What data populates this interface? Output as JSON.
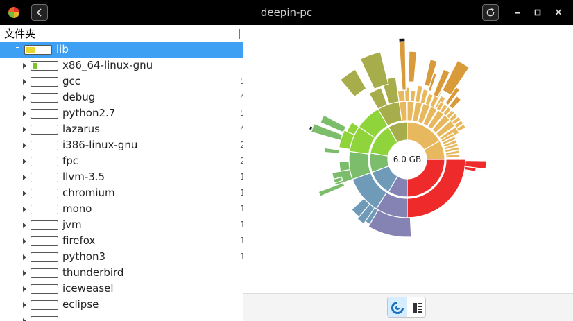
{
  "window": {
    "title": "deepin-pc"
  },
  "icons": {
    "app": "disk-usage-app-icon",
    "back": "back-arrow-icon",
    "reload": "reload-icon",
    "minimize": "minimize-icon",
    "maximize": "maximize-icon",
    "close": "close-icon",
    "chart_view": "sunburst-view-icon",
    "list_view": "list-view-icon"
  },
  "tree": {
    "column_header": "文件夹",
    "rows": [
      {
        "label": "lib",
        "selected": true,
        "expanded": true,
        "fill": "#e8d72e",
        "fill_level": 0.35,
        "clip": ""
      },
      {
        "label": "x86_64-linux-gnu",
        "fill": "#7cc42a",
        "fill_level": 0.2,
        "clip": ""
      },
      {
        "label": "gcc",
        "fill": "#ffffff",
        "fill_level": 0,
        "clip": "5"
      },
      {
        "label": "debug",
        "fill": "#ffffff",
        "fill_level": 0,
        "clip": "4"
      },
      {
        "label": "python2.7",
        "fill": "#ffffff",
        "fill_level": 0,
        "clip": "5"
      },
      {
        "label": "lazarus",
        "fill": "#ffffff",
        "fill_level": 0,
        "clip": "4"
      },
      {
        "label": "i386-linux-gnu",
        "fill": "#ffffff",
        "fill_level": 0,
        "clip": "2"
      },
      {
        "label": "fpc",
        "fill": "#ffffff",
        "fill_level": 0,
        "clip": "2"
      },
      {
        "label": "llvm-3.5",
        "fill": "#ffffff",
        "fill_level": 0,
        "clip": "1"
      },
      {
        "label": "chromium",
        "fill": "#ffffff",
        "fill_level": 0,
        "clip": "1"
      },
      {
        "label": "mono",
        "fill": "#ffffff",
        "fill_level": 0,
        "clip": "1"
      },
      {
        "label": "jvm",
        "fill": "#ffffff",
        "fill_level": 0,
        "clip": "1"
      },
      {
        "label": "firefox",
        "fill": "#ffffff",
        "fill_level": 0,
        "clip": "1"
      },
      {
        "label": "python3",
        "fill": "#ffffff",
        "fill_level": 0,
        "clip": "1"
      },
      {
        "label": "thunderbird",
        "fill": "#ffffff",
        "fill_level": 0,
        "clip": ""
      },
      {
        "label": "iceweasel",
        "fill": "#ffffff",
        "fill_level": 0,
        "clip": ""
      },
      {
        "label": "eclipse",
        "fill": "#ffffff",
        "fill_level": 0,
        "clip": ""
      },
      {
        "label": "",
        "fill": "#ffffff",
        "fill_level": 0,
        "clip": ""
      }
    ]
  },
  "chart": {
    "center_label": "6.0 GB",
    "colors": {
      "red": "#ee2a2a",
      "purple": "#8583b4",
      "blue": "#6f9ab8",
      "green": "#7cbd6b",
      "lime": "#8fd43a",
      "olive": "#a6ad4a",
      "tan": "#e8b85e",
      "orange": "#d99a3a"
    }
  }
}
